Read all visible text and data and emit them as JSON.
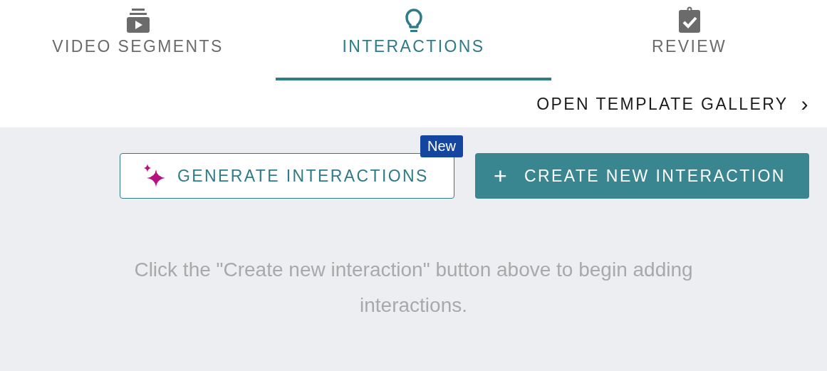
{
  "tabs": [
    {
      "label": "VIDEO SEGMENTS",
      "kind": "video",
      "selected": false
    },
    {
      "label": "INTERACTIONS",
      "kind": "bulb",
      "selected": true
    },
    {
      "label": "REVIEW",
      "kind": "clipboard",
      "selected": false
    }
  ],
  "gallery_link": {
    "label": "OPEN TEMPLATE GALLERY",
    "chevron": "›"
  },
  "actions": [
    {
      "kind": "outline",
      "label": "GENERATE INTERACTIONS",
      "badge": "New"
    },
    {
      "kind": "primary",
      "label": "CREATE NEW INTERACTION",
      "icon_text": "+"
    }
  ],
  "empty_message": "Click the \"Create new interaction\" button above to begin adding interactions."
}
